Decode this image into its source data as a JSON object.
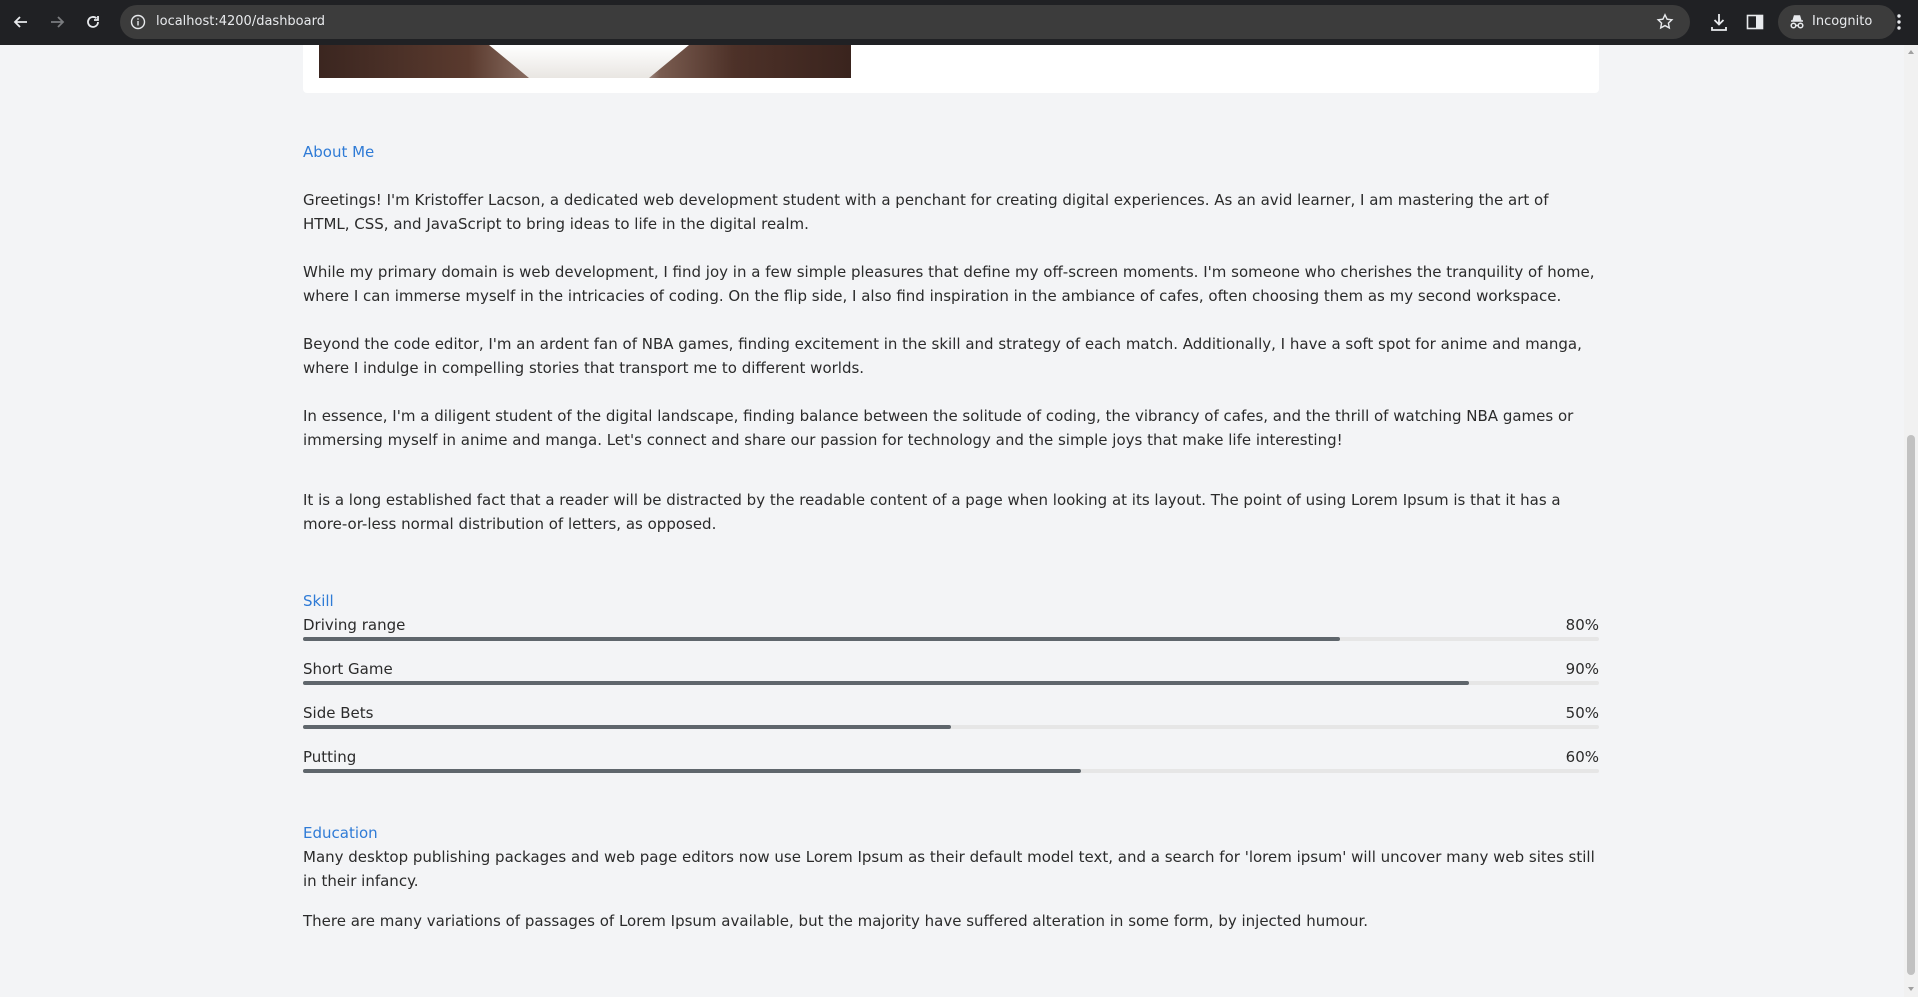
{
  "browser": {
    "url": "localhost:4200/dashboard",
    "mode_label": "Incognito"
  },
  "about": {
    "title": "About Me",
    "paragraphs": [
      "Greetings! I'm Kristoffer Lacson, a dedicated web development student with a penchant for creating digital experiences. As an avid learner, I am mastering the art of HTML, CSS, and JavaScript to bring ideas to life in the digital realm.",
      "While my primary domain is web development, I find joy in a few simple pleasures that define my off-screen moments. I'm someone who cherishes the tranquility of home, where I can immerse myself in the intricacies of coding. On the flip side, I also find inspiration in the ambiance of cafes, often choosing them as my second workspace.",
      "Beyond the code editor, I'm an ardent fan of NBA games, finding excitement in the skill and strategy of each match. Additionally, I have a soft spot for anime and manga, where I indulge in compelling stories that transport me to different worlds.",
      "In essence, I'm a diligent student of the digital landscape, finding balance between the solitude of coding, the vibrancy of cafes, and the thrill of watching NBA games or immersing myself in anime and manga. Let's connect and share our passion for technology and the simple joys that make life interesting!",
      "It is a long established fact that a reader will be distracted by the readable content of a page when looking at its layout. The point of using Lorem Ipsum is that it has a more-or-less normal distribution of letters, as opposed."
    ]
  },
  "skills": {
    "title": "Skill",
    "items": [
      {
        "label": "Driving range",
        "percent_label": "80%",
        "value": 80
      },
      {
        "label": "Short Game",
        "percent_label": "90%",
        "value": 90
      },
      {
        "label": "Side Bets",
        "percent_label": "50%",
        "value": 50
      },
      {
        "label": "Putting",
        "percent_label": "60%",
        "value": 60
      }
    ]
  },
  "education": {
    "title": "Education",
    "paragraphs": [
      "Many desktop publishing packages and web page editors now use Lorem Ipsum as their default model text, and a search for 'lorem ipsum' will uncover many web sites still in their infancy.",
      "There are many variations of passages of Lorem Ipsum available, but the majority have suffered alteration in some form, by injected humour."
    ]
  },
  "colors": {
    "accent": "#2f7bd6",
    "bar_fill": "#5f666c",
    "bar_track": "#e6e6e6"
  }
}
